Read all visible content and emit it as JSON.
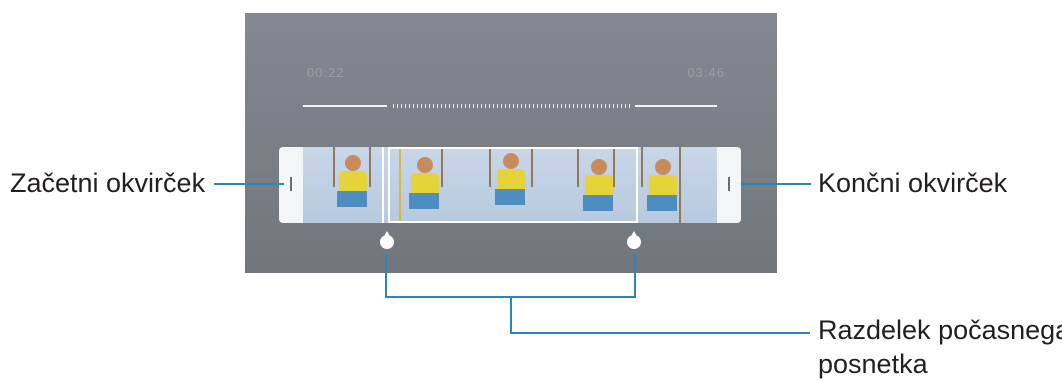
{
  "labels": {
    "start_frame": "Začetni okvirček",
    "end_frame": "Končni okvirček",
    "clip_section_line1": "Razdelek počasnega",
    "clip_section_line2": "posnetka"
  },
  "player": {
    "time_start": "00:22",
    "time_end": "03:46"
  },
  "colors": {
    "callout_line": "#2e86b8",
    "screen_bg": "#7a7e84",
    "selection_border": "#ffffff"
  }
}
